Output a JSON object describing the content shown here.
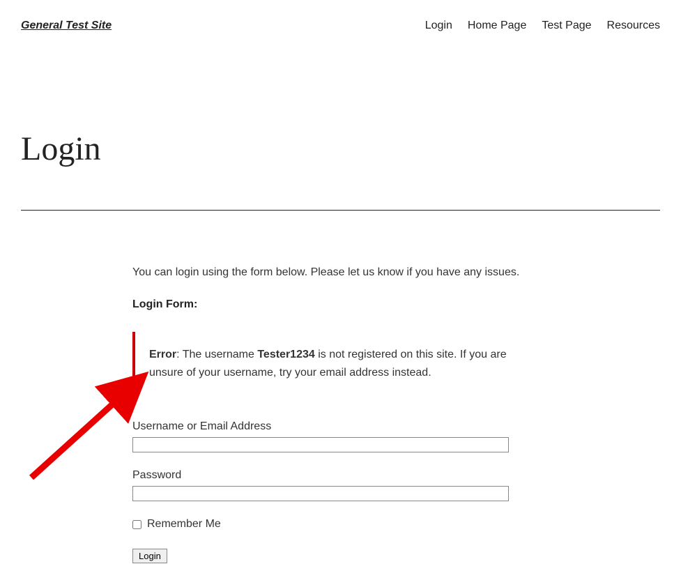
{
  "header": {
    "site_title": "General Test Site",
    "nav": {
      "login": "Login",
      "home": "Home Page",
      "test": "Test Page",
      "resources": "Resources"
    }
  },
  "page_heading": "Login",
  "intro_text": "You can login using the form below. Please let us know if you have any issues.",
  "form_title": "Login Form:",
  "error": {
    "label": "Error",
    "sep": ": The username ",
    "username": "Tester1234",
    "rest": " is not registered on this site. If you are unsure of your username, try your email address instead."
  },
  "fields": {
    "username_label": "Username or Email Address",
    "username_value": "",
    "password_label": "Password",
    "password_value": ""
  },
  "remember_label": "Remember Me",
  "login_button": "Login"
}
